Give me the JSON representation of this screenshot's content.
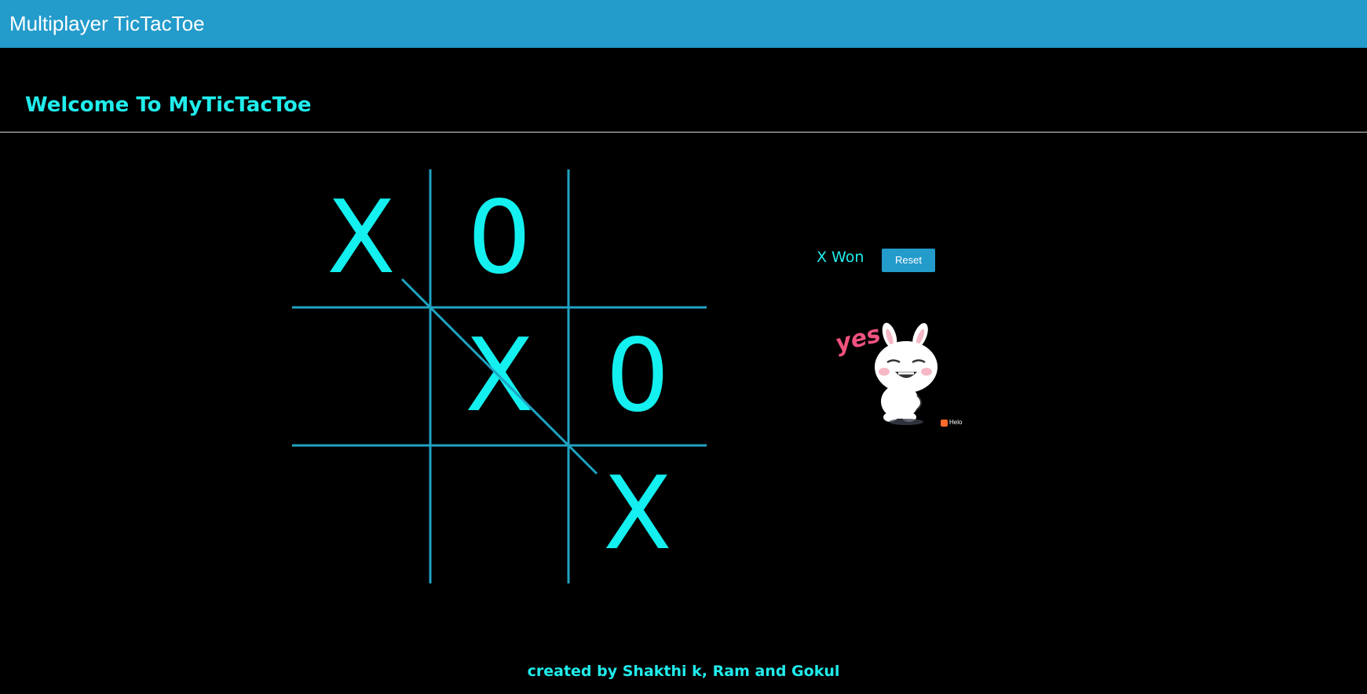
{
  "appbar": {
    "title": "Multiplayer TicTacToe"
  },
  "header": {
    "welcome": "Welcome To MyTicTacToe"
  },
  "board": {
    "cells": [
      [
        "X",
        "0",
        ""
      ],
      [
        "",
        "X",
        "0"
      ],
      [
        "",
        "",
        "X"
      ]
    ],
    "winning_line": "diagonal-top-left-to-bottom-right"
  },
  "game": {
    "status": "X Won",
    "reset_label": "Reset"
  },
  "sticker": {
    "text": "yes",
    "brand": "Helo"
  },
  "footer": {
    "credits": "created by Shakthi k, Ram and Gokul"
  },
  "colors": {
    "appbar": "#239bcb",
    "accent": "#21ecec",
    "mark": "#13f0ef",
    "grid": "#1fa3c4",
    "background": "#000000"
  }
}
